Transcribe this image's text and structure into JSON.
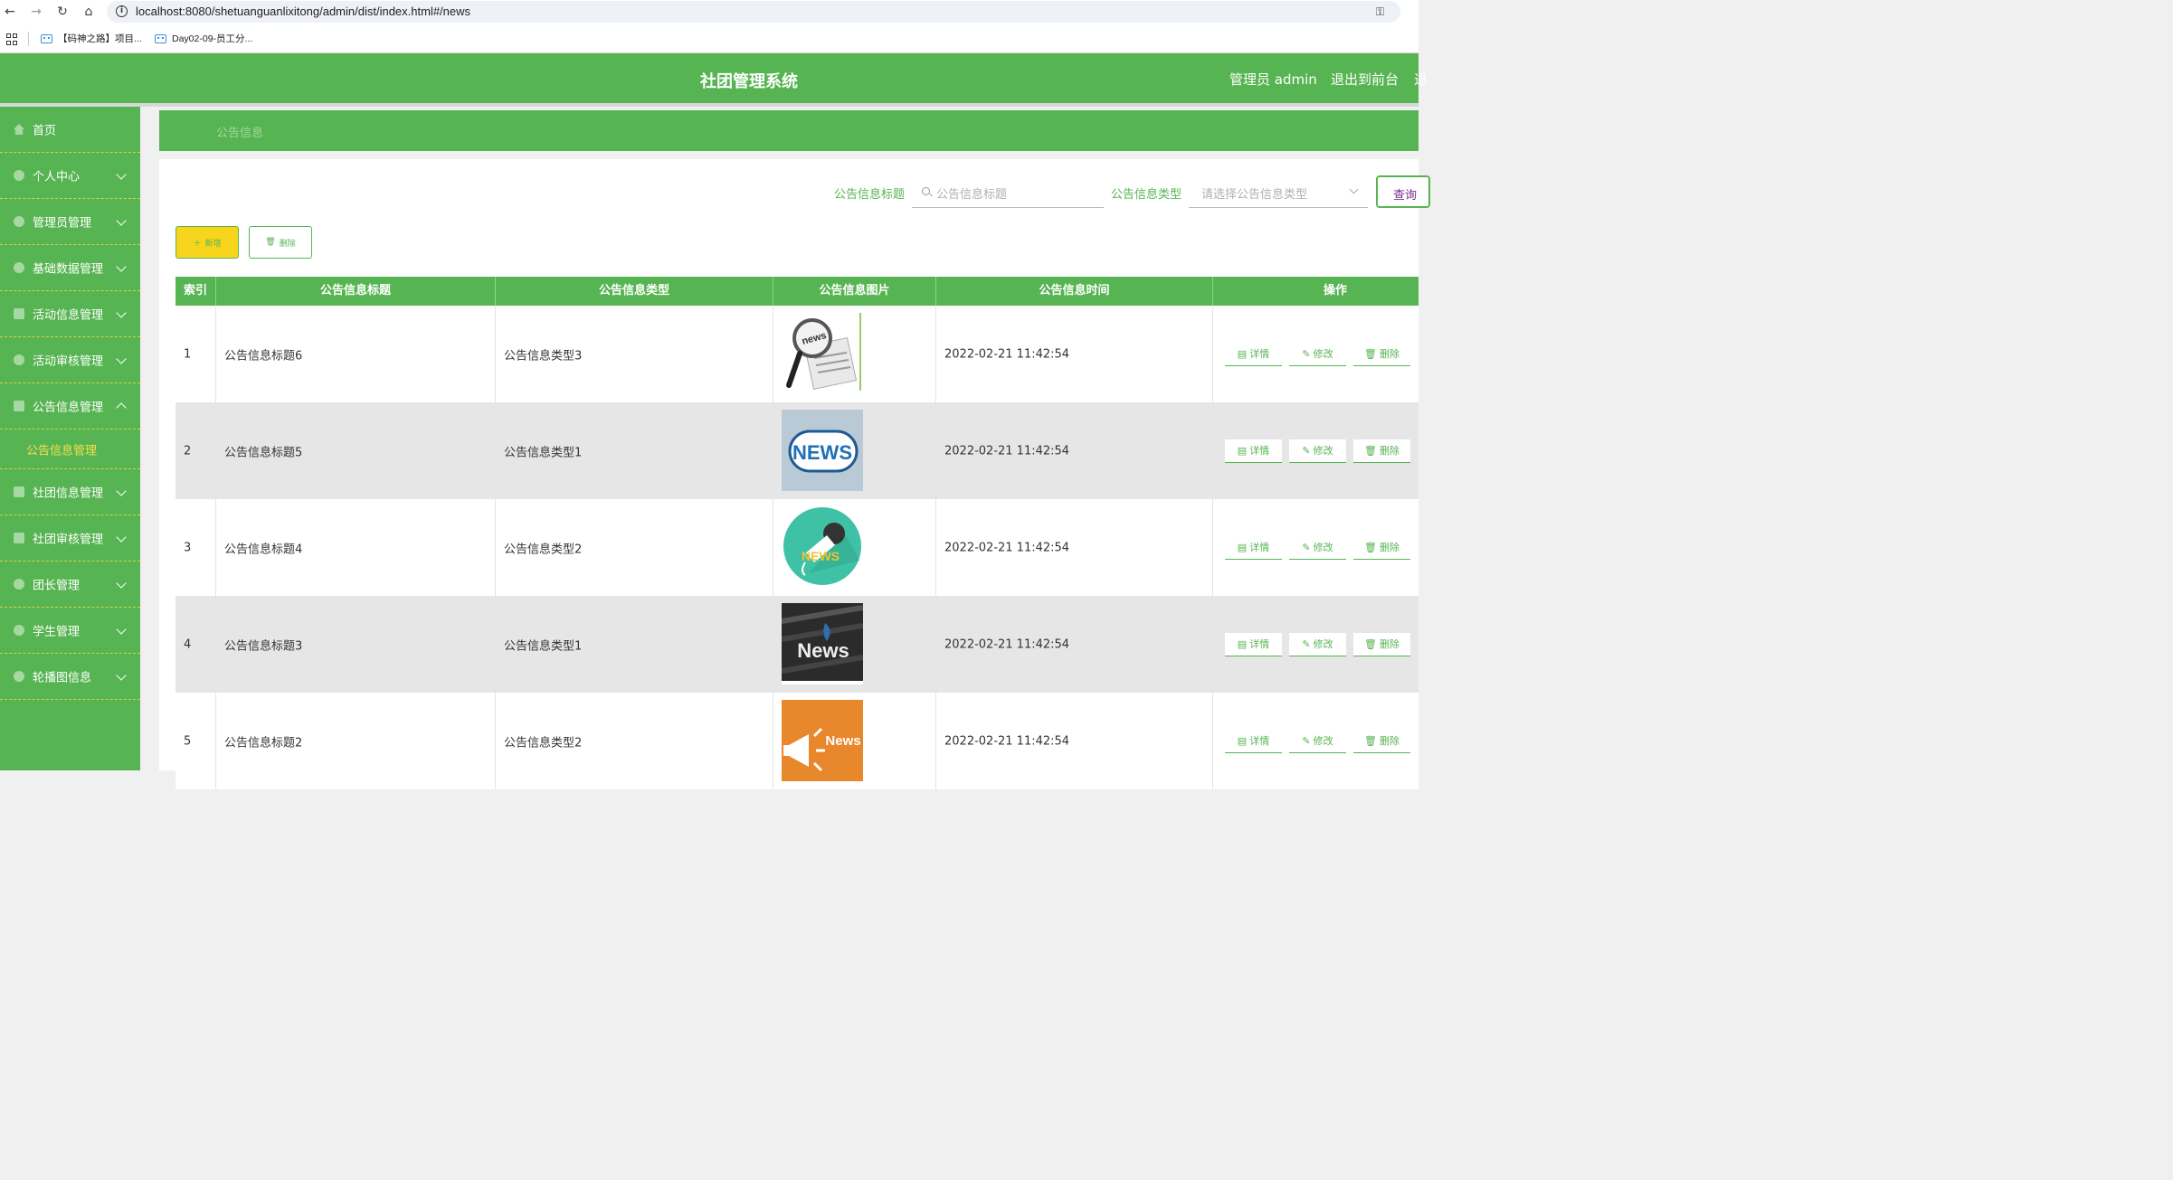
{
  "browser": {
    "url": "localhost:8080/shetuanguanlixitong/admin/dist/index.html#/news",
    "bookmarks": [
      "【码神之路】项目...",
      "Day02-09-员工分..."
    ]
  },
  "header": {
    "title": "社团管理系统",
    "user": "管理员 admin",
    "exit": "退出到前台",
    "more": "退"
  },
  "sidebar": {
    "items": [
      {
        "label": "首页",
        "icon": "home-icon"
      },
      {
        "label": "个人中心",
        "icon": "user-icon"
      },
      {
        "label": "管理员管理",
        "icon": "user-icon"
      },
      {
        "label": "基础数据管理",
        "icon": "gear-icon"
      },
      {
        "label": "活动信息管理",
        "icon": "folder-icon"
      },
      {
        "label": "活动审核管理",
        "icon": "user-icon"
      },
      {
        "label": "公告信息管理",
        "icon": "chart-icon"
      },
      {
        "label": "社团信息管理",
        "icon": "monitor-icon"
      },
      {
        "label": "社团审核管理",
        "icon": "building-icon"
      },
      {
        "label": "团长管理",
        "icon": "person-icon"
      },
      {
        "label": "学生管理",
        "icon": "person-icon"
      },
      {
        "label": "轮播图信息",
        "icon": "settings-icon"
      }
    ],
    "sub_active": "公告信息管理"
  },
  "breadcrumb": "公告信息",
  "search": {
    "title_label": "公告信息标题",
    "title_placeholder": "公告信息标题",
    "type_label": "公告信息类型",
    "type_placeholder": "请选择公告信息类型",
    "query_button": "查询"
  },
  "toolbar": {
    "add_label": "新增",
    "delete_label": "删除"
  },
  "table": {
    "columns": [
      "索引",
      "公告信息标题",
      "公告信息类型",
      "公告信息图片",
      "公告信息时间",
      "操作"
    ],
    "rows": [
      {
        "index": "1",
        "title": "公告信息标题6",
        "type": "公告信息类型3",
        "time": "2022-02-21 11:42:54",
        "image": "magnifier-news"
      },
      {
        "index": "2",
        "title": "公告信息标题5",
        "type": "公告信息类型1",
        "time": "2022-02-21 11:42:54",
        "image": "news-badge"
      },
      {
        "index": "3",
        "title": "公告信息标题4",
        "type": "公告信息类型2",
        "time": "2022-02-21 11:42:54",
        "image": "microphone-news"
      },
      {
        "index": "4",
        "title": "公告信息标题3",
        "type": "公告信息类型1",
        "time": "2022-02-21 11:42:54",
        "image": "dark-news"
      },
      {
        "index": "5",
        "title": "公告信息标题2",
        "type": "公告信息类型2",
        "time": "2022-02-21 11:42:54",
        "image": "megaphone-news"
      }
    ],
    "actions": {
      "detail": "详情",
      "edit": "修改",
      "delete": "删除"
    }
  },
  "image_text": {
    "row2": "NEWS",
    "row3": "NEWS",
    "row4": "News",
    "row5": "News",
    "row1": "news"
  },
  "colors": {
    "primary": "#57b452",
    "accent": "#f7d51d",
    "active_sub": "#f4e04d"
  }
}
